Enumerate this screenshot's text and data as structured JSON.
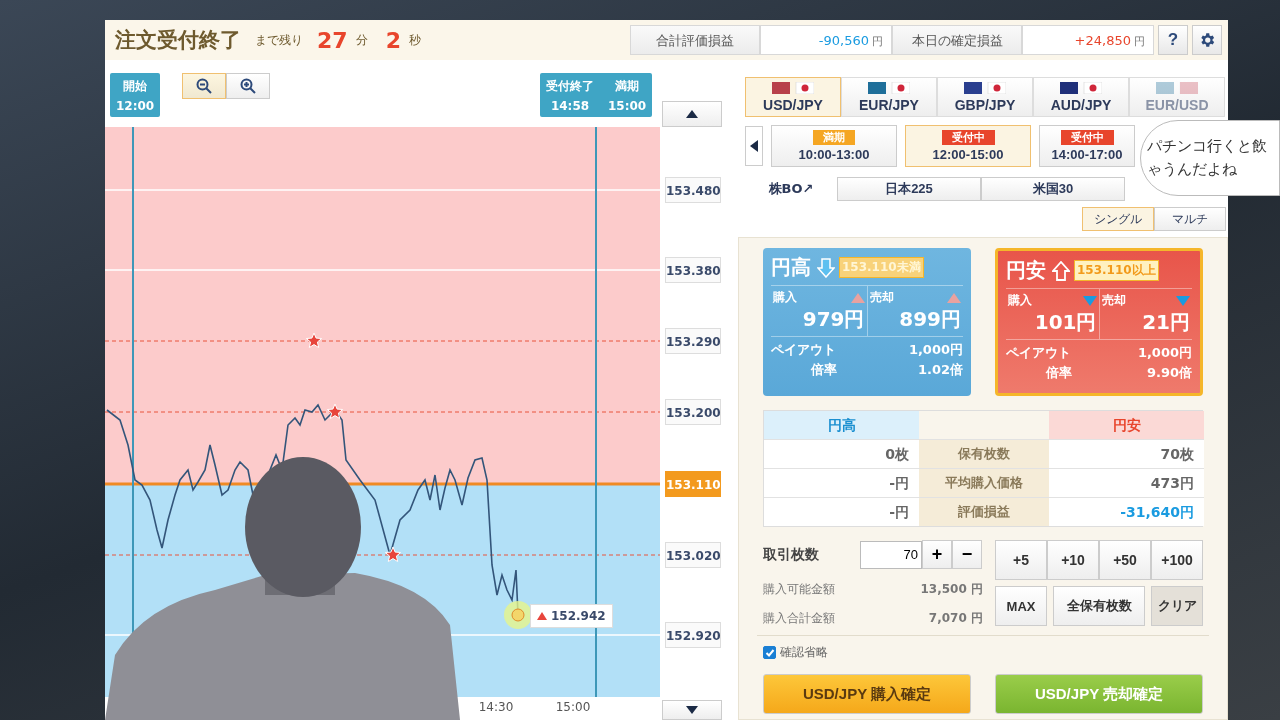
{
  "header": {
    "title": "注文受付終了",
    "remaining_label": "まで残り",
    "minutes": "27",
    "minutes_unit": "分",
    "seconds": "2",
    "seconds_unit": "秒",
    "summary": [
      {
        "label": "合計評価損益",
        "value": "-90,560",
        "unit": "円",
        "kind": "loss"
      },
      {
        "label": "本日の確定損益",
        "value": "+24,850",
        "unit": "円",
        "kind": "gain"
      }
    ],
    "help": "?"
  },
  "chart": {
    "markers": [
      {
        "kind": "start",
        "columns": [
          {
            "label": "開始",
            "time": "12:00"
          }
        ]
      },
      {
        "kind": "end",
        "columns": [
          {
            "label": "受付終了",
            "time": "14:58"
          },
          {
            "label": "満期",
            "time": "15:00"
          }
        ]
      }
    ],
    "price_levels": [
      {
        "price": "153.480",
        "kind": "grid"
      },
      {
        "price": "153.380",
        "kind": "grid"
      },
      {
        "price": "153.290",
        "kind": "strike"
      },
      {
        "price": "153.200",
        "kind": "strike"
      },
      {
        "price": "153.110",
        "kind": "target"
      },
      {
        "price": "153.020",
        "kind": "strike"
      },
      {
        "price": "152.920",
        "kind": "grid"
      }
    ],
    "current_price": "152.942",
    "time_labels": [
      "14:30",
      "15:00"
    ]
  },
  "currency_tabs": [
    {
      "label": "USD/JPY",
      "selected": true,
      "disabled": false
    },
    {
      "label": "EUR/JPY",
      "selected": false,
      "disabled": false
    },
    {
      "label": "GBP/JPY",
      "selected": false,
      "disabled": false
    },
    {
      "label": "AUD/JPY",
      "selected": false,
      "disabled": false
    },
    {
      "label": "EUR/USD",
      "selected": false,
      "disabled": true
    }
  ],
  "sessions": [
    {
      "status": "満期",
      "kind": "expired",
      "time": "10:00-13:00",
      "selected": false
    },
    {
      "status": "受付中",
      "kind": "open",
      "time": "12:00-15:00",
      "selected": true
    },
    {
      "status": "受付中",
      "kind": "open",
      "time": "14:00-17:00",
      "selected": false
    }
  ],
  "stock_bo": {
    "label": "株BO↗",
    "buttons": [
      "日本225",
      "米国30"
    ]
  },
  "mode_toggle": [
    {
      "label": "シングル",
      "selected": true
    },
    {
      "label": "マルチ",
      "selected": false
    }
  ],
  "options": [
    {
      "kind": "yen_up",
      "title": "円高",
      "threshold": "153.110未満",
      "buy_label": "購入",
      "sell_label": "売却",
      "buy_price": "979円",
      "sell_price": "899円",
      "payout_label": "ペイアウト",
      "payout": "1,000円",
      "rate_label": "倍率",
      "rate": "1.02倍",
      "selected": false
    },
    {
      "kind": "yen_down",
      "title": "円安",
      "threshold": "153.110以上",
      "buy_label": "購入",
      "sell_label": "売却",
      "buy_price": "101円",
      "sell_price": "21円",
      "payout_label": "ペイアウト",
      "payout": "1,000円",
      "rate_label": "倍率",
      "rate": "9.90倍",
      "selected": true
    }
  ],
  "positions": {
    "left_heading": "円高",
    "right_heading": "円安",
    "rows": [
      {
        "left": "0枚",
        "label": "保有枚数",
        "right": "70枚",
        "negative": false
      },
      {
        "left": "-円",
        "label": "平均購入価格",
        "right": "473円",
        "negative": false
      },
      {
        "left": "-円",
        "label": "評価損益",
        "right": "-31,640円",
        "negative": true
      }
    ]
  },
  "order": {
    "label": "取引枚数",
    "quantity": "70",
    "plus": "+",
    "minus": "−",
    "available_label": "購入可能金額",
    "available": "13,500 円",
    "total_label": "購入合計金額",
    "total": "7,070 円",
    "quick": [
      "+5",
      "+10",
      "+50",
      "+100"
    ],
    "actions": [
      "MAX",
      "全保有枚数",
      "クリア"
    ],
    "skip_confirm": {
      "label": "確認省略",
      "checked": true
    }
  },
  "submit": [
    {
      "label": "USD/JPY 購入確定",
      "kind": "buy"
    },
    {
      "label": "USD/JPY 売却確定",
      "kind": "sell"
    }
  ],
  "overlay": {
    "speech_bubble": [
      "パチンコ行くと飲",
      "ゃうんだよね"
    ]
  }
}
